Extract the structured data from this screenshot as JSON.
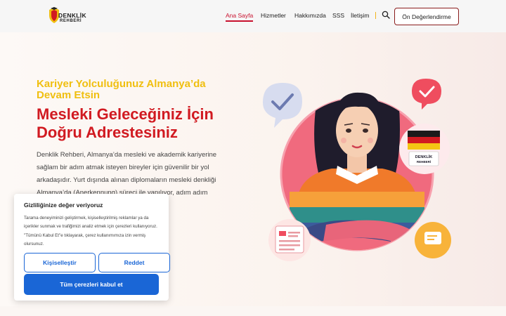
{
  "header": {
    "logo_line1": "DENKLİK",
    "logo_line2": "REHBERİ",
    "nav": [
      "Ana Sayfa",
      "Hizmetler",
      "Hakkımızda",
      "SSS",
      "İletişim"
    ],
    "cta_label": "Ön Değerlendirme"
  },
  "hero": {
    "kicker": "Kariyer Yolculuğunuz Almanya’da Devam Etsin",
    "headline": "Mesleki Geleceğiniz İçin Doğru Adrestesiniz",
    "body": "Denklik Rehberi, Almanya’da mesleki ve akademik kariyerine sağlam bir adım atmak isteyen bireyler için güvenilir bir yol arkadaşıdır. Yurt dışında alınan diplomaların mesleki denkliği Almanya’da (Anerkennung) süreci ile yapılıyor, adım adım"
  },
  "illustration": {
    "flag_caption_line1": "DENKLİK",
    "flag_caption_line2": "REHBERİ"
  },
  "cookie": {
    "title": "Gizliliğinize değer veriyoruz",
    "text": "Tarama deneyiminizi geliştirmek, kişiselleştirilmiş reklamlar ya da içerikler sunmak ve trafiğimizi analiz etmek için çerezleri kullanıyoruz. \"Tümünü Kabul Et\"e tıklayarak, çerez kullanımımıza izin vermiş olursunuz.",
    "customize_label": "Kişiselleştir",
    "reject_label": "Reddet",
    "accept_label": "Tüm çerezleri kabul et"
  },
  "colors": {
    "brand_red": "#d11a21",
    "accent_yellow": "#f0bf10",
    "button_blue": "#1a66d6"
  }
}
